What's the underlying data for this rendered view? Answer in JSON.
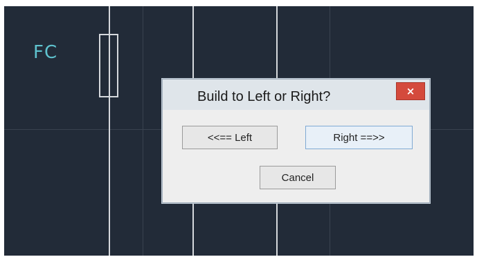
{
  "canvas": {
    "label": "FC"
  },
  "dialog": {
    "title": "Build to Left or Right?",
    "close_label": "×",
    "left_label": "<<== Left",
    "right_label": "Right ==>>",
    "cancel_label": "Cancel"
  },
  "colors": {
    "canvas_background": "#222b38",
    "label_color": "#5fc3cf",
    "close_button": "#d44a3c"
  }
}
